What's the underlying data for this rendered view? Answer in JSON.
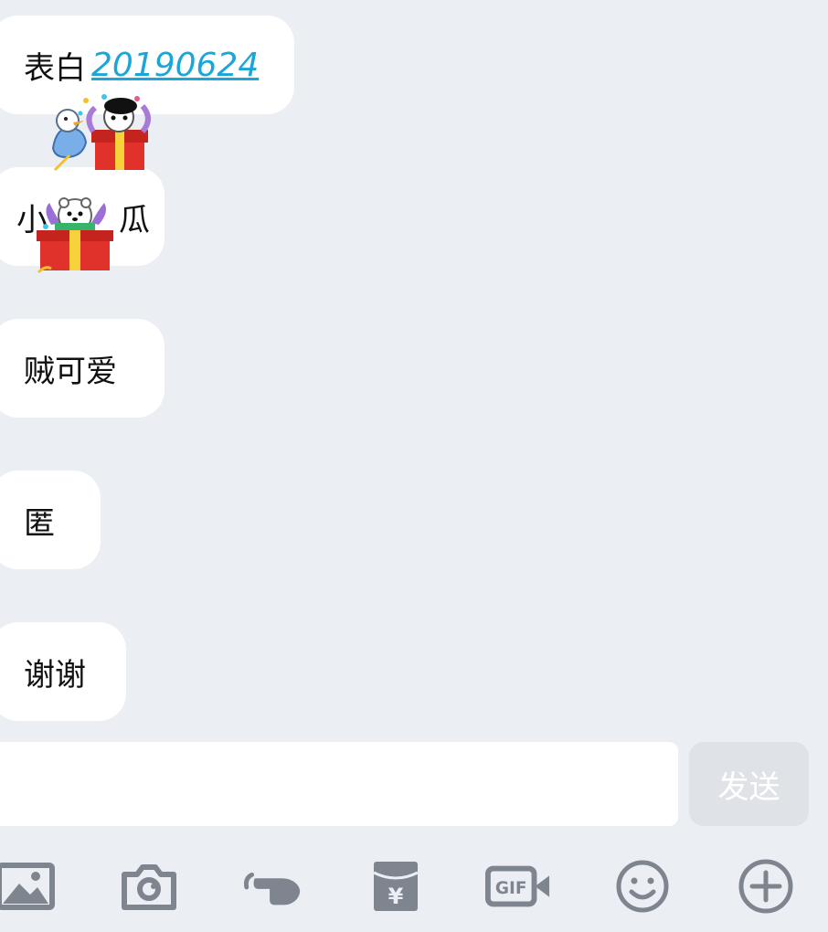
{
  "messages": [
    {
      "prefix": "表白",
      "link": "20190624"
    },
    {
      "text_left": "小",
      "text_right": "瓜"
    },
    {
      "text": "贼可爱"
    },
    {
      "text": "匿"
    },
    {
      "text": "谢谢"
    }
  ],
  "composer": {
    "input_value": "",
    "send_label": "发送"
  },
  "toolbar": {
    "icons": [
      "image-icon",
      "camera-icon",
      "poke-icon",
      "red-packet-icon",
      "gif-icon",
      "emoji-icon",
      "plus-icon"
    ],
    "gif_text": "GIF",
    "red_packet_symbol": "¥"
  },
  "colors": {
    "background": "#ebeff4",
    "bubble": "#ffffff",
    "link": "#1aa6d8",
    "icon": "#7f858f",
    "send_button_bg": "#dfe3e8"
  }
}
